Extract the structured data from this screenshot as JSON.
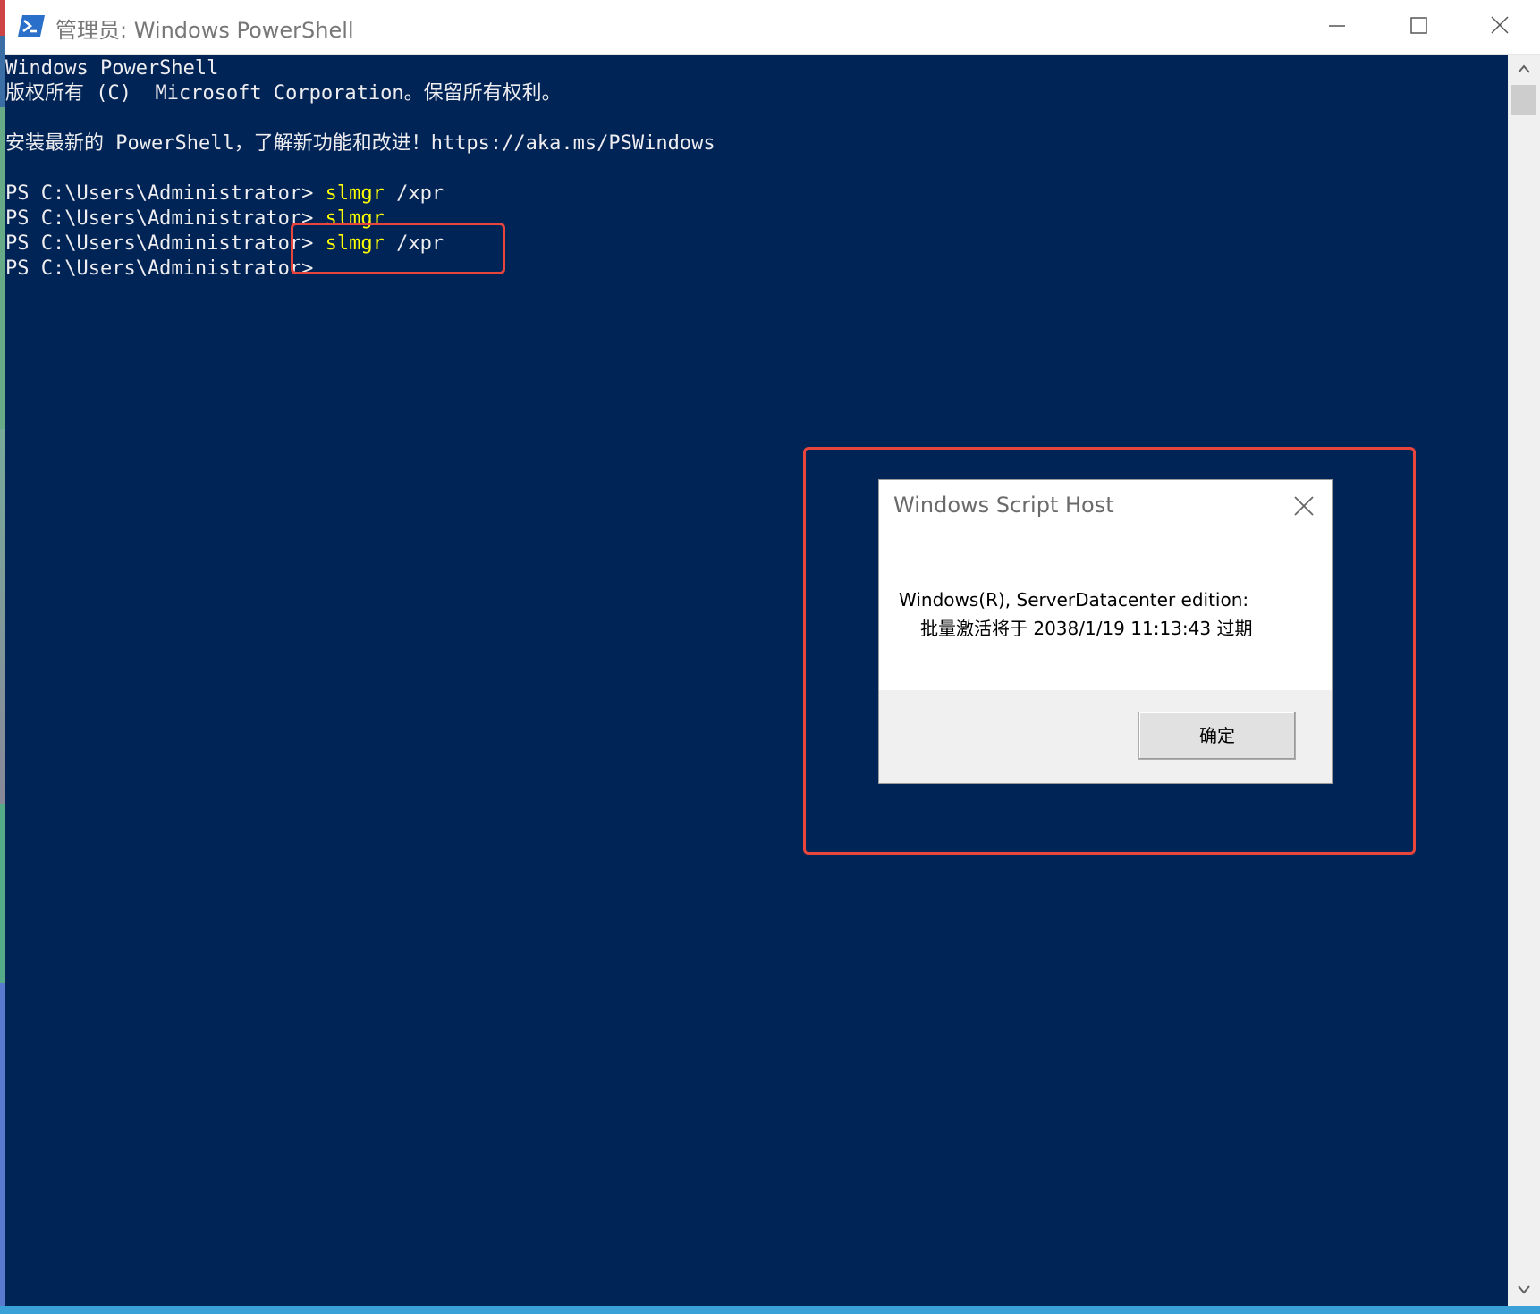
{
  "window": {
    "title": "管理员: Windows PowerShell",
    "icon": "powershell-icon",
    "controls": [
      "minimize-icon",
      "maximize-icon",
      "close-icon"
    ]
  },
  "console": {
    "lines": [
      {
        "prompt": "Windows PowerShell",
        "cmd": ""
      },
      {
        "prompt": "版权所有 (C)  Microsoft Corporation。保留所有权利。",
        "cmd": ""
      },
      {
        "prompt": "",
        "cmd": ""
      },
      {
        "prompt": "安装最新的 PowerShell，了解新功能和改进！https://aka.ms/PSWindows",
        "cmd": ""
      },
      {
        "prompt": "",
        "cmd": ""
      },
      {
        "prompt": "PS C:\\Users\\Administrator> ",
        "cmd": "slmgr",
        "args": " /xpr"
      },
      {
        "prompt": "PS C:\\Users\\Administrator> ",
        "cmd": "slmgr",
        "args": ""
      },
      {
        "prompt": "PS C:\\Users\\Administrator> ",
        "cmd": "slmgr",
        "args": " /xpr"
      },
      {
        "prompt": "PS C:\\Users\\Administrator>",
        "cmd": "",
        "args": ""
      }
    ],
    "background_color": "#012456",
    "command_color": "#ffff00"
  },
  "dialog": {
    "title": "Windows Script Host",
    "message_line1": "Windows(R), ServerDatacenter edition:",
    "message_line2": "批量激活将于 2038/1/19 11:13:43 过期",
    "ok_label": "确定"
  },
  "annotation_color": "#e8453c"
}
